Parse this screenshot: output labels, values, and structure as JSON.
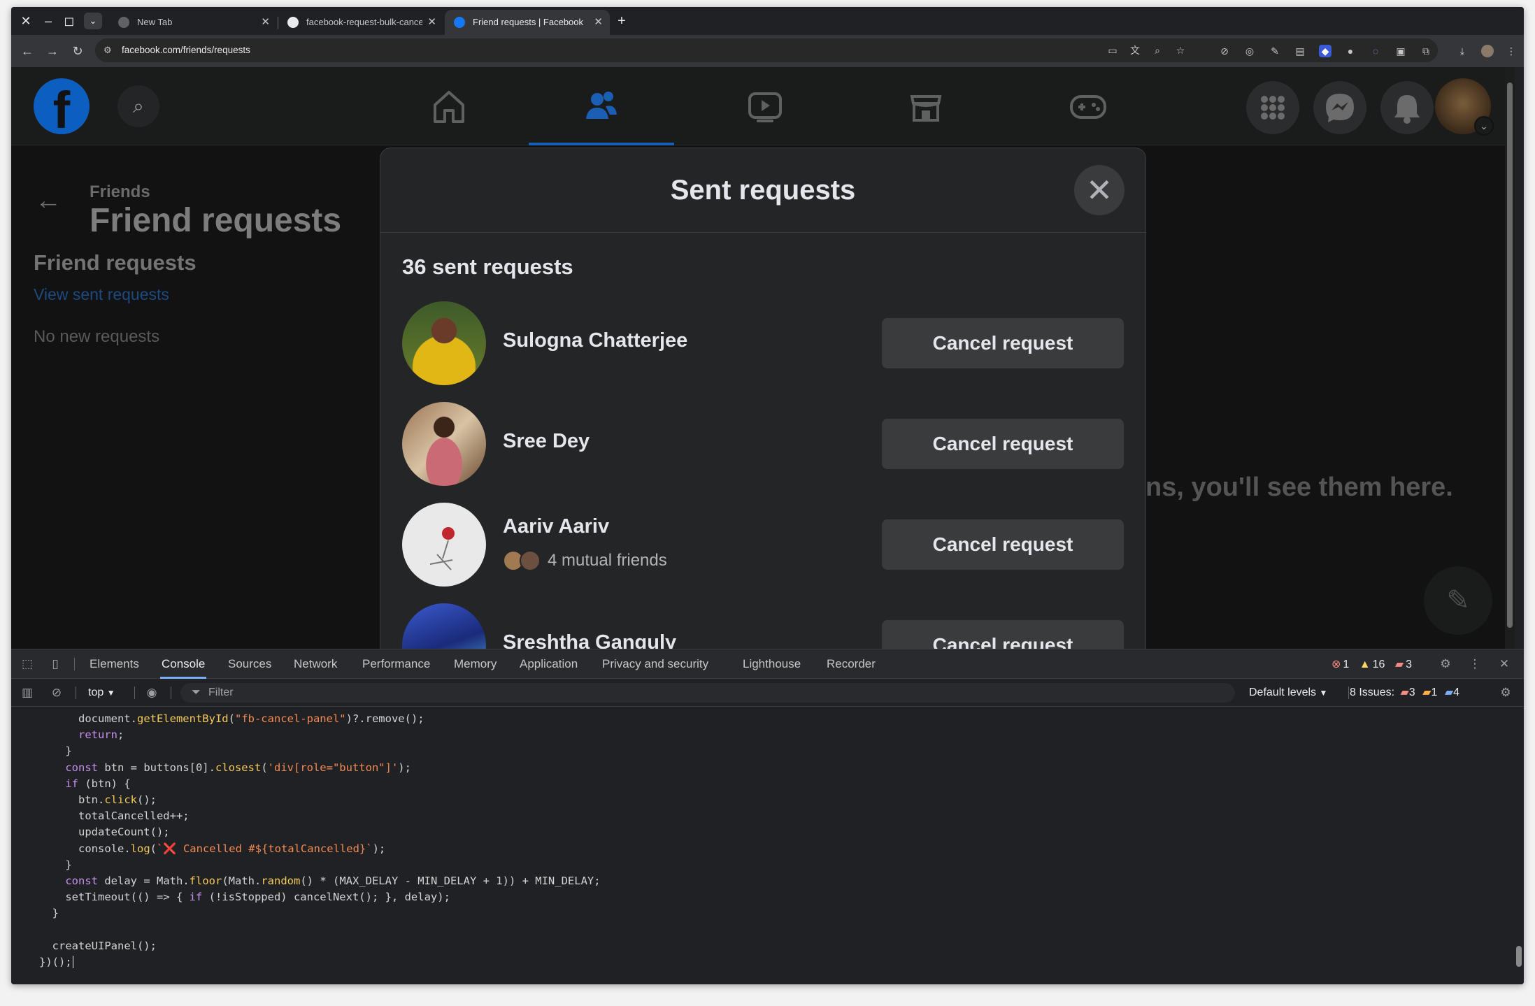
{
  "browser": {
    "tabs": [
      {
        "title": "New Tab",
        "active": false
      },
      {
        "title": "facebook-request-bulk-cancel",
        "active": false
      },
      {
        "title": "Friend requests | Facebook",
        "active": true
      }
    ],
    "url": "facebook.com/friends/requests"
  },
  "page": {
    "breadcrumb": "Friends",
    "title": "Friend requests",
    "section_title": "Friend requests",
    "view_sent_link": "View sent requests",
    "no_requests": "No new requests",
    "bg_message": "ns, you'll see them here."
  },
  "modal": {
    "title": "Sent requests",
    "count": "36 sent requests",
    "requests": [
      {
        "name": "Sulogna Chatterjee",
        "mutual": "",
        "button": "Cancel request"
      },
      {
        "name": "Sree Dey",
        "mutual": "",
        "button": "Cancel request"
      },
      {
        "name": "Aariv Aariv",
        "mutual": "4 mutual friends",
        "button": "Cancel request"
      },
      {
        "name": "Sreshtha Ganguly",
        "mutual": "",
        "button": "Cancel request"
      }
    ]
  },
  "devtools": {
    "tabs": [
      "Elements",
      "Console",
      "Sources",
      "Network",
      "Performance",
      "Memory",
      "Application",
      "Privacy and security",
      "Lighthouse",
      "Recorder"
    ],
    "active_tab": "Console",
    "counts": {
      "errors": "1",
      "warnings": "16",
      "info": "3"
    },
    "context": "top",
    "filter_placeholder": "Filter",
    "levels": "Default levels",
    "issues": {
      "label": "8 Issues:",
      "errors": "3",
      "warnings": "1",
      "info": "4"
    },
    "code_lines": [
      "      document.getElementById(\"fb-cancel-panel\")?.remove();",
      "      return;",
      "    }",
      "    const btn = buttons[0].closest('div[role=\"button\"]');",
      "    if (btn) {",
      "      btn.click();",
      "      totalCancelled++;",
      "      updateCount();",
      "      console.log(`❌ Cancelled #${totalCancelled}`);",
      "    }",
      "    const delay = Math.floor(Math.random() * (MAX_DELAY - MIN_DELAY + 1)) + MIN_DELAY;",
      "    setTimeout(() => { if (!isStopped) cancelNext(); }, delay);",
      "  }",
      "",
      "  createUIPanel();",
      "})();"
    ]
  }
}
